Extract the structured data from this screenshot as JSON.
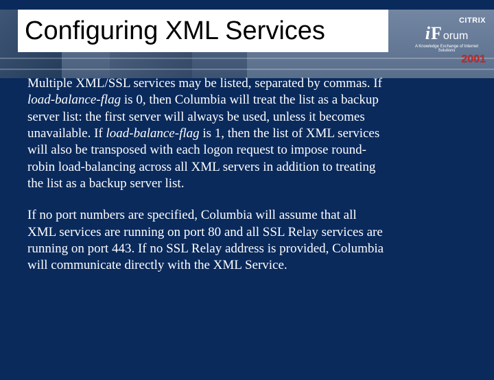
{
  "title": "Configuring XML Services",
  "logo": {
    "brand": "CITRIX",
    "i": "i",
    "F": "F",
    "rest": "orum",
    "tagline": "A Knowledge Exchange of Internet Solutions",
    "year": "2001"
  },
  "body": {
    "p1": {
      "t1": "Multiple XML/SSL services may be listed, separated by commas.  If ",
      "i1": "load-balance-flag",
      "t2": " is 0, then Columbia will treat the list as a backup server list:  the first server will always be used, unless it becomes unavailable.  If ",
      "i2": "load-balance-flag",
      "t3": " is 1, then the list of XML services will also be transposed with each logon request to impose round-robin load-balancing across all XML servers in addition to treating the list as a backup server list."
    },
    "p2": "If no port numbers are specified, Columbia will assume that all XML services are running on port 80 and all SSL Relay services are running on port 443.  If no SSL Relay address is provided, Columbia will communicate directly with the XML Service."
  }
}
